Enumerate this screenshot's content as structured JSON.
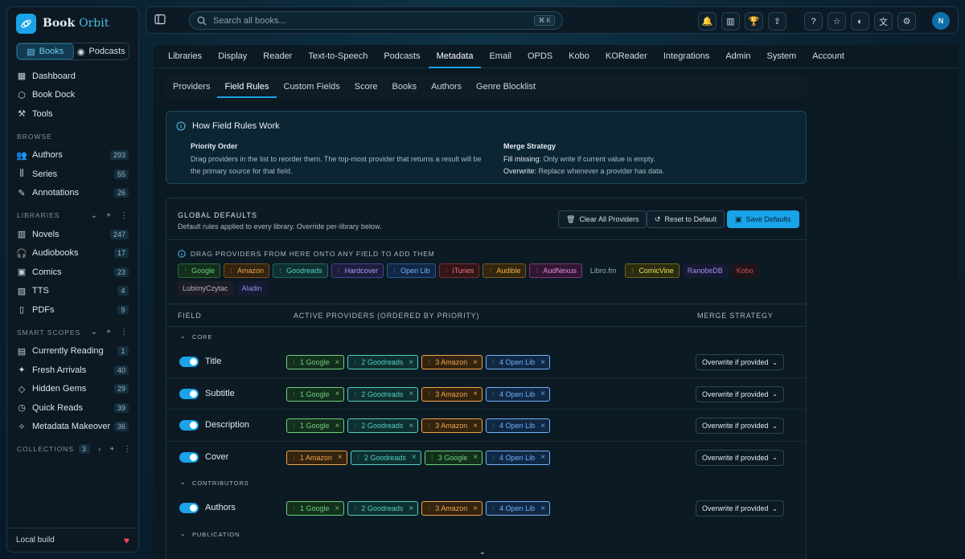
{
  "brand": {
    "name_a": "Book",
    "name_b": "Orbit"
  },
  "modes": [
    {
      "label": "Books"
    },
    {
      "label": "Podcasts"
    }
  ],
  "nav": [
    {
      "label": "Dashboard"
    },
    {
      "label": "Book Dock"
    },
    {
      "label": "Tools"
    }
  ],
  "browse": {
    "title": "BROWSE",
    "items": [
      {
        "label": "Authors",
        "count": "293"
      },
      {
        "label": "Series",
        "count": "55"
      },
      {
        "label": "Annotations",
        "count": "26"
      }
    ]
  },
  "libraries": {
    "title": "LIBRARIES",
    "items": [
      {
        "label": "Novels",
        "count": "247"
      },
      {
        "label": "Audiobooks",
        "count": "17"
      },
      {
        "label": "Comics",
        "count": "23"
      },
      {
        "label": "TTS",
        "count": "4"
      },
      {
        "label": "PDFs",
        "count": "9"
      }
    ]
  },
  "smart_scopes": {
    "title": "SMART SCOPES",
    "items": [
      {
        "label": "Currently Reading",
        "count": "1"
      },
      {
        "label": "Fresh Arrivals",
        "count": "40"
      },
      {
        "label": "Hidden Gems",
        "count": "29"
      },
      {
        "label": "Quick Reads",
        "count": "39"
      },
      {
        "label": "Metadata Makeover",
        "count": "36"
      }
    ]
  },
  "collections": {
    "title": "COLLECTIONS",
    "count": "3"
  },
  "footer": {
    "label": "Local build"
  },
  "search": {
    "placeholder": "Search all books...",
    "shortcut": "⌘ K"
  },
  "user": {
    "initial": "N"
  },
  "tabs1": [
    "Libraries",
    "Display",
    "Reader",
    "Text-to-Speech",
    "Podcasts",
    "Metadata",
    "Email",
    "OPDS",
    "Kobo",
    "KOReader",
    "Integrations",
    "Admin",
    "System",
    "Account"
  ],
  "tabs2": [
    "Providers",
    "Field Rules",
    "Custom Fields",
    "Score",
    "Books",
    "Authors",
    "Genre Blocklist"
  ],
  "info": {
    "title": "How Field Rules Work",
    "priority_title": "Priority Order",
    "priority_line1": "Drag providers in the list to reorder them. The top-most provider that returns a result will be",
    "priority_line2": "the primary source for that field.",
    "merge_title": "Merge Strategy",
    "fill_label": "Fill missing:",
    "fill_text": " Only write if current value is empty.",
    "over_label": "Overwrite:",
    "over_text": " Replace whenever a provider has data."
  },
  "defaults": {
    "title": "GLOBAL DEFAULTS",
    "subtitle": "Default rules applied to every library. Override per-library below.",
    "clear_label": "Clear All Providers",
    "reset_label": "Reset to Default",
    "save_label": "Save Defaults",
    "drag_title": "DRAG PROVIDERS FROM HERE ONTO ANY FIELD TO ADD THEM"
  },
  "providers": [
    {
      "label": "Google",
      "style": "c-green",
      "grip": true
    },
    {
      "label": "Amazon",
      "style": "c-orange",
      "grip": true
    },
    {
      "label": "Goodreads",
      "style": "c-teal",
      "grip": true
    },
    {
      "label": "Hardcover",
      "style": "c-purple",
      "grip": true
    },
    {
      "label": "Open Lib",
      "style": "c-blue",
      "grip": true
    },
    {
      "label": "iTunes",
      "style": "c-red",
      "grip": true
    },
    {
      "label": "Audible",
      "style": "c-amber",
      "grip": true
    },
    {
      "label": "AudNexus",
      "style": "c-pink",
      "grip": true
    },
    {
      "label": "Libro.fm",
      "style": "c-plain",
      "grip": false
    },
    {
      "label": "ComicVine",
      "style": "c-yellow",
      "grip": true
    },
    {
      "label": "RanobeDB",
      "style": "c-violet",
      "grip": false
    },
    {
      "label": "Kobo",
      "style": "c-crimson",
      "grip": false
    },
    {
      "label": "LubimyCzytac",
      "style": "c-grey",
      "grip": false
    },
    {
      "label": "Aladin",
      "style": "c-indigo",
      "grip": false
    }
  ],
  "table": {
    "col_field": "FIELD",
    "col_providers": "ACTIVE PROVIDERS (ORDERED BY PRIORITY)",
    "col_merge": "MERGE STRATEGY"
  },
  "groups": [
    {
      "title": "CORE",
      "rows": [
        {
          "name": "Title",
          "merge": "Overwrite if provided",
          "chips": [
            {
              "label": "1 Google",
              "style": "c-green"
            },
            {
              "label": "2 Goodreads",
              "style": "c-teal"
            },
            {
              "label": "3 Amazon",
              "style": "c-orange"
            },
            {
              "label": "4 Open Lib",
              "style": "c-blue"
            }
          ]
        },
        {
          "name": "Subtitle",
          "merge": "Overwrite if provided",
          "chips": [
            {
              "label": "1 Google",
              "style": "c-green"
            },
            {
              "label": "2 Goodreads",
              "style": "c-teal"
            },
            {
              "label": "3 Amazon",
              "style": "c-orange"
            },
            {
              "label": "4 Open Lib",
              "style": "c-blue"
            }
          ]
        },
        {
          "name": "Description",
          "merge": "Overwrite if provided",
          "chips": [
            {
              "label": "1 Google",
              "style": "c-green"
            },
            {
              "label": "2 Goodreads",
              "style": "c-teal"
            },
            {
              "label": "3 Amazon",
              "style": "c-orange"
            },
            {
              "label": "4 Open Lib",
              "style": "c-blue"
            }
          ]
        },
        {
          "name": "Cover",
          "merge": "Overwrite if provided",
          "chips": [
            {
              "label": "1 Amazon",
              "style": "c-orange"
            },
            {
              "label": "2 Goodreads",
              "style": "c-teal"
            },
            {
              "label": "3 Google",
              "style": "c-green"
            },
            {
              "label": "4 Open Lib",
              "style": "c-blue"
            }
          ]
        }
      ]
    },
    {
      "title": "CONTRIBUTORS",
      "rows": [
        {
          "name": "Authors",
          "merge": "Overwrite if provided",
          "chips": [
            {
              "label": "1 Google",
              "style": "c-green"
            },
            {
              "label": "2 Goodreads",
              "style": "c-teal"
            },
            {
              "label": "3 Amazon",
              "style": "c-orange"
            },
            {
              "label": "4 Open Lib",
              "style": "c-blue"
            }
          ]
        }
      ]
    },
    {
      "title": "PUBLICATION",
      "rows": []
    }
  ]
}
